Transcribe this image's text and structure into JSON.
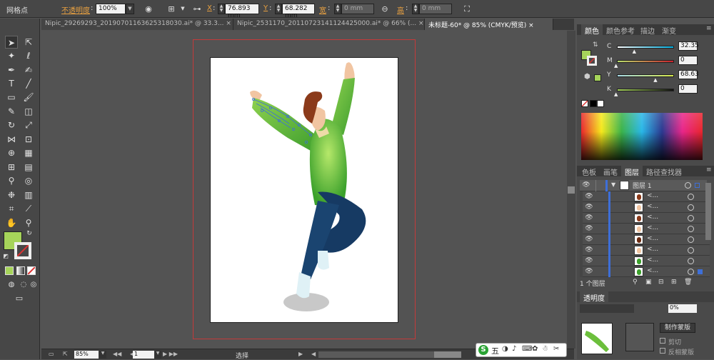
{
  "control_bar": {
    "tool_name": "网格点",
    "opacity_label": "不透明度",
    "opacity_value": "100%",
    "x_label": "X",
    "x_value": "76.893 mm",
    "y_label": "Y",
    "y_value": "68.282 mm",
    "width_label": "宽",
    "width_value": "0 mm",
    "height_label": "高",
    "height_value": "0 mm",
    "colon": ":"
  },
  "doc_tabs": [
    {
      "label": "Nipic_29269293_20190701163625318030.ai* @ 33.3...",
      "close": "×"
    },
    {
      "label": "Nipic_2531170_20110723141124425000.ai* @ 66% (...",
      "close": "×"
    },
    {
      "label": "未标题-60* @ 85% (CMYK/预览)",
      "close": "×"
    }
  ],
  "status_bar": {
    "zoom": "85%",
    "page": "1",
    "tool_status": "选择"
  },
  "color_panel": {
    "tabs": [
      "颜色",
      "颜色参考",
      "描边",
      "渐变"
    ],
    "channels": [
      {
        "label": "C",
        "value": "32.35",
        "fraction": 0.32
      },
      {
        "label": "M",
        "value": "0",
        "fraction": 0.0
      },
      {
        "label": "Y",
        "value": "68.63",
        "fraction": 0.69
      },
      {
        "label": "K",
        "value": "0",
        "fraction": 0.0
      }
    ],
    "fill_color": "#a6d45a"
  },
  "layers_panel": {
    "tabs": [
      "色板",
      "画笔",
      "图层",
      "路径查找器"
    ],
    "top_layer_name": "图层 1",
    "sublayer_name": "<...",
    "sublayer_count": 8,
    "footer_text": "1 个图层"
  },
  "transparency_panel": {
    "title": "透明度",
    "opacity_value": "0%",
    "make_mask_button": "制作蒙版",
    "clip_label": "剪切",
    "invert_label": "反相蒙版"
  },
  "ime_bar": {
    "brand": "S",
    "mode": "五"
  },
  "colors": {
    "fill": "#a6d45a",
    "selection_blue": "#3e6fd8",
    "artboard_border": "#c43a3a"
  }
}
